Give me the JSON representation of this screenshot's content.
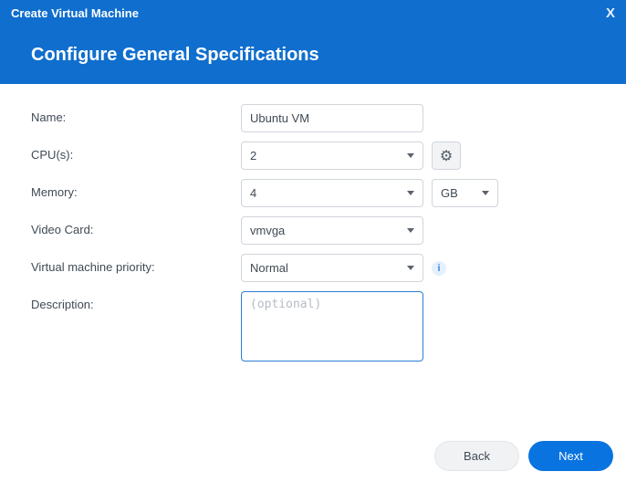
{
  "dialog": {
    "title": "Create Virtual Machine"
  },
  "step": {
    "heading": "Configure General Specifications"
  },
  "form": {
    "name": {
      "label": "Name:",
      "value": "Ubuntu VM"
    },
    "cpus": {
      "label": "CPU(s):",
      "value": "2"
    },
    "memory": {
      "label": "Memory:",
      "value": "4",
      "unit": "GB"
    },
    "videocard": {
      "label": "Video Card:",
      "value": "vmvga"
    },
    "priority": {
      "label": "Virtual machine priority:",
      "value": "Normal"
    },
    "description": {
      "label": "Description:",
      "placeholder": "(optional)",
      "value": ""
    }
  },
  "footer": {
    "back": "Back",
    "next": "Next"
  },
  "icons": {
    "close": "X",
    "info": "i",
    "gear": "⚙"
  }
}
